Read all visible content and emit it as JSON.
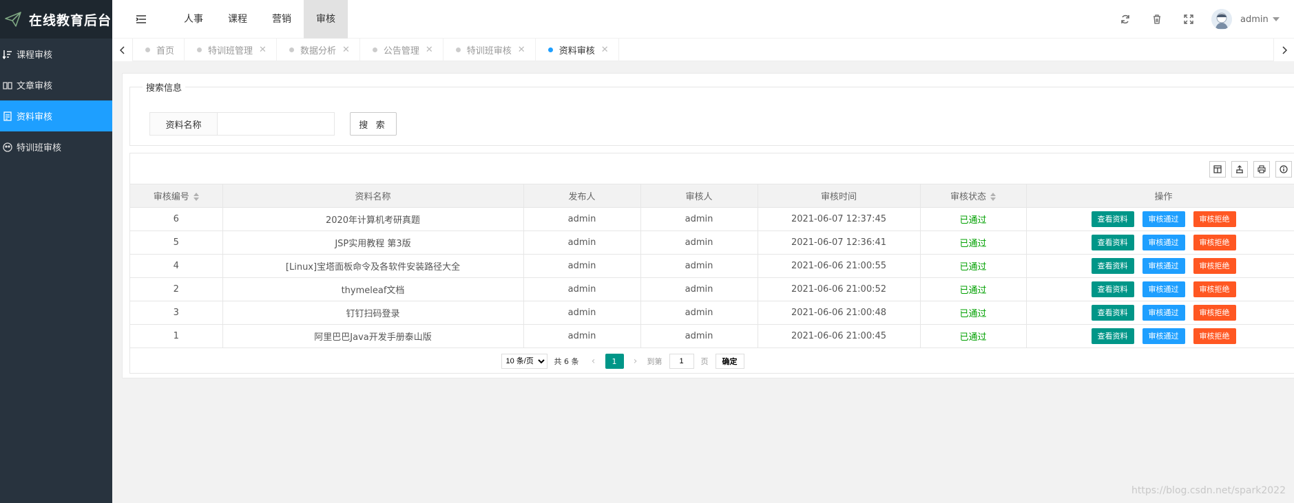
{
  "app": {
    "title": "在线教育后台"
  },
  "sidebar": {
    "items": [
      {
        "label": "课程审核",
        "icon": "sort-list-icon",
        "active": false
      },
      {
        "label": "文章审核",
        "icon": "book-icon",
        "active": false
      },
      {
        "label": "资料审核",
        "icon": "document-icon",
        "active": true
      },
      {
        "label": "特训班审核",
        "icon": "users-icon",
        "active": false
      }
    ]
  },
  "header": {
    "nav": [
      {
        "label": "人事",
        "active": false
      },
      {
        "label": "课程",
        "active": false
      },
      {
        "label": "营销",
        "active": false
      },
      {
        "label": "审核",
        "active": true
      }
    ],
    "user": {
      "name": "admin"
    }
  },
  "tabs": [
    {
      "label": "首页",
      "closable": false,
      "active": false
    },
    {
      "label": "特训班管理",
      "closable": true,
      "active": false
    },
    {
      "label": "数据分析",
      "closable": true,
      "active": false
    },
    {
      "label": "公告管理",
      "closable": true,
      "active": false
    },
    {
      "label": "特训班审核",
      "closable": true,
      "active": false
    },
    {
      "label": "资料审核",
      "closable": true,
      "active": true
    }
  ],
  "search": {
    "legend": "搜索信息",
    "label": "资料名称",
    "value": "",
    "placeholder": "",
    "button": "搜 索"
  },
  "table": {
    "columns": [
      {
        "label": "审核编号",
        "sortable": true
      },
      {
        "label": "资料名称",
        "sortable": false
      },
      {
        "label": "发布人",
        "sortable": false
      },
      {
        "label": "审核人",
        "sortable": false
      },
      {
        "label": "审核时间",
        "sortable": false
      },
      {
        "label": "审核状态",
        "sortable": true
      },
      {
        "label": "操作",
        "sortable": false
      }
    ],
    "actions": {
      "view": "查看资料",
      "approve": "审核通过",
      "reject": "审核拒绝"
    },
    "rows": [
      {
        "id": "6",
        "name": "2020年计算机考研真题",
        "publisher": "admin",
        "reviewer": "admin",
        "time": "2021-06-07 12:37:45",
        "status": "已通过"
      },
      {
        "id": "5",
        "name": "JSP实用教程 第3版",
        "publisher": "admin",
        "reviewer": "admin",
        "time": "2021-06-07 12:36:41",
        "status": "已通过"
      },
      {
        "id": "4",
        "name": "[Linux]宝塔面板命令及各软件安装路径大全",
        "publisher": "admin",
        "reviewer": "admin",
        "time": "2021-06-06 21:00:55",
        "status": "已通过"
      },
      {
        "id": "2",
        "name": "thymeleaf文档",
        "publisher": "admin",
        "reviewer": "admin",
        "time": "2021-06-06 21:00:52",
        "status": "已通过"
      },
      {
        "id": "3",
        "name": "钉钉扫码登录",
        "publisher": "admin",
        "reviewer": "admin",
        "time": "2021-06-06 21:00:48",
        "status": "已通过"
      },
      {
        "id": "1",
        "name": "阿里巴巴Java开发手册泰山版",
        "publisher": "admin",
        "reviewer": "admin",
        "time": "2021-06-06 21:00:45",
        "status": "已通过"
      }
    ]
  },
  "pagination": {
    "per_page": "10 条/页",
    "total": "共 6 条",
    "current": "1",
    "goto_label": "到第",
    "goto_value": "1",
    "page_unit": "页",
    "confirm": "确定"
  },
  "watermark": "https://blog.csdn.net/spark2022",
  "colors": {
    "sidebar": "#28333e",
    "active": "#1e9fff",
    "teal": "#009688",
    "orange": "#ff5722",
    "status": "#00a000"
  }
}
